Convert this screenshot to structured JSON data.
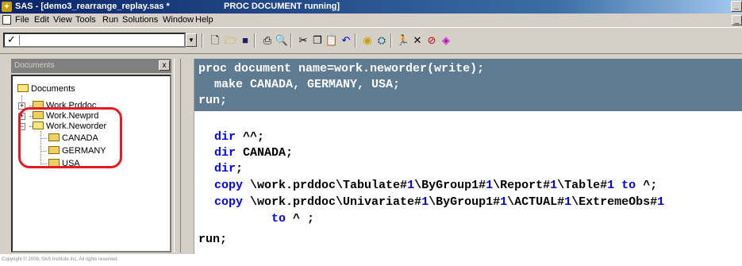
{
  "window": {
    "title": "SAS - [demo3_rearrange_replay.sas *",
    "status": "PROC DOCUMENT running]",
    "minimize_glyph": "_",
    "app_icon": "sas-logo-icon"
  },
  "menubar": {
    "items": [
      "File",
      "Edit",
      "View",
      "Tools",
      "Run",
      "Solutions",
      "Window",
      "Help"
    ]
  },
  "toolbar": {
    "command_check": "✓",
    "command_value": "",
    "icons": [
      "new-icon",
      "open-icon",
      "save-icon",
      "print-icon",
      "print-preview-icon",
      "cut-icon",
      "copy-icon",
      "paste-icon",
      "undo-icon",
      "libraries-icon",
      "explorer-icon",
      "run-icon",
      "clear-icon",
      "stop-icon",
      "help-icon"
    ]
  },
  "documents_pane": {
    "header": "Documents",
    "close_glyph": "x",
    "tree": {
      "root": "Documents",
      "items": [
        {
          "label": "Work.Prddoc",
          "expanded": false
        },
        {
          "label": "Work.Newprd",
          "expanded": false
        },
        {
          "label": "Work.Neworder",
          "expanded": true,
          "children": [
            "CANADA",
            "GERMANY",
            "USA"
          ]
        }
      ]
    },
    "highlight_color": "#e31b23"
  },
  "editor": {
    "lines": {
      "l1_kw": "proc document",
      "l1_rest": " name=work.neworder(write);",
      "l2": "make CANADA, GERMANY, USA;",
      "l3": "run;",
      "l4_kw": "dir",
      "l4_rest": " ^^;",
      "l5_kw": "dir",
      "l5_rest": " CANADA;",
      "l6_kw": "dir",
      "l6_rest": ";",
      "l7_kw": "copy",
      "l7_a": " \\work.prddoc\\Tabulate#",
      "l7_n1": "1",
      "l7_b": "\\ByGroup1#",
      "l7_n2": "1",
      "l7_c": "\\Report#",
      "l7_n3": "1",
      "l7_d": "\\Table#",
      "l7_n4": "1",
      "l7_to": " to",
      "l7_end": " ^;",
      "l8_kw": "copy",
      "l8_a": " \\work.prddoc\\Univariate#",
      "l8_n1": "1",
      "l8_b": "\\ByGroup1#",
      "l8_n2": "1",
      "l8_c": "\\ACTUAL#",
      "l8_n3": "1",
      "l8_d": "\\ExtremeObs#",
      "l8_n4": "1",
      "l9_to": "to",
      "l9_end": " ^ ;",
      "l10": "run;"
    },
    "selection_color": "#5e7b92"
  },
  "footer": {
    "copyright": "Copyright © 2008, SAS Institute Inc. All rights reserved."
  }
}
